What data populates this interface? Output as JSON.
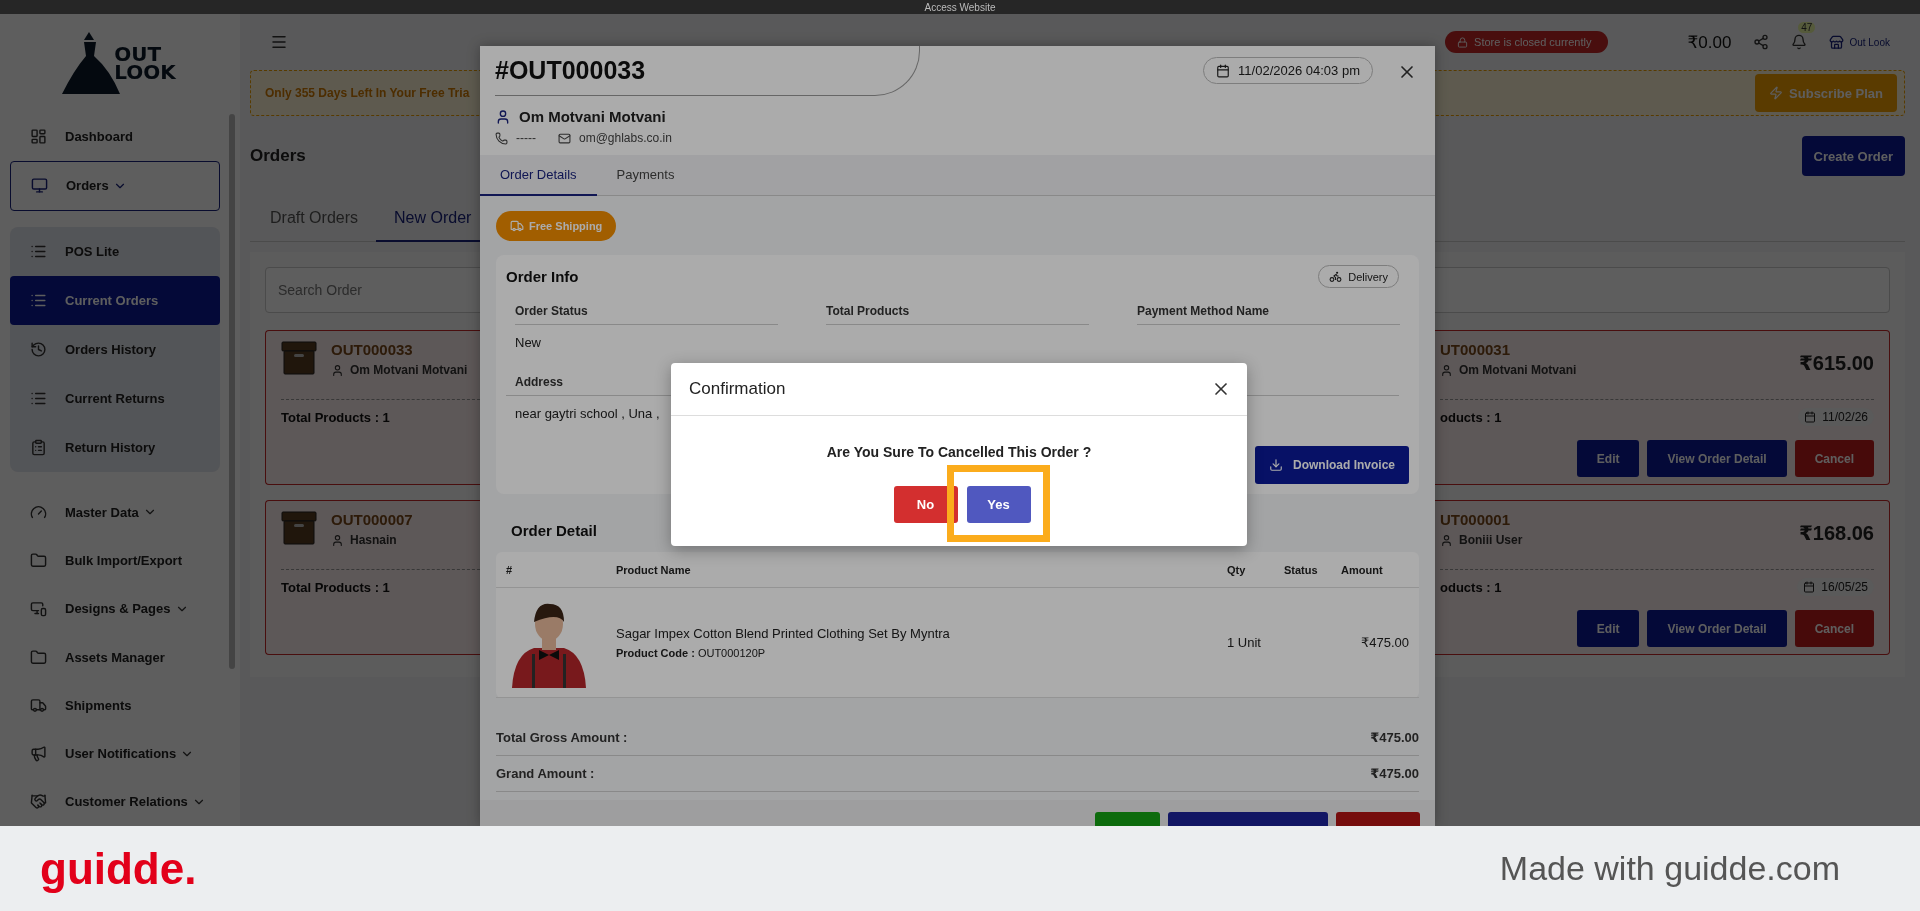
{
  "top_bar": {
    "title": "Access Website"
  },
  "sidebar": {
    "logo": {
      "line1": "OUT",
      "line2": "LOOK"
    },
    "items": [
      {
        "label": "Dashboard",
        "expandable": false,
        "expanded": false
      },
      {
        "label": "Orders",
        "expandable": true,
        "expanded": true,
        "children": [
          {
            "label": "POS Lite",
            "selected": false
          },
          {
            "label": "Current Orders",
            "selected": true
          },
          {
            "label": "Orders History",
            "selected": false
          },
          {
            "label": "Current Returns",
            "selected": false
          },
          {
            "label": "Return History",
            "selected": false
          }
        ]
      },
      {
        "label": "Master Data",
        "expandable": true,
        "expanded": false
      },
      {
        "label": "Bulk Import/Export",
        "expandable": false,
        "expanded": false
      },
      {
        "label": "Designs & Pages",
        "expandable": true,
        "expanded": false
      },
      {
        "label": "Assets Manager",
        "expandable": false,
        "expanded": false
      },
      {
        "label": "Shipments",
        "expandable": false,
        "expanded": false
      },
      {
        "label": "User Notifications",
        "expandable": true,
        "expanded": false
      },
      {
        "label": "Customer Relations",
        "expandable": true,
        "expanded": false
      }
    ]
  },
  "header": {
    "store_status": "Store is closed currently",
    "balance": "₹0.00",
    "notification_count": "47",
    "store_name": "Out Look"
  },
  "trial_banner": {
    "text": "Only 355 Days Left In Your Free Tria",
    "button": "Subscribe Plan"
  },
  "page": {
    "title": "Orders",
    "create_button": "Create Order",
    "tabs": [
      {
        "label": "Draft Orders",
        "selected": false
      },
      {
        "label": "New Order",
        "selected": true
      }
    ],
    "search": {
      "placeholder": "Search Order"
    }
  },
  "orders_left": [
    {
      "id": "OUT000033",
      "customer": "Om Motvani Motvani",
      "total_products": "Total Products : 1"
    },
    {
      "id": "OUT000007",
      "customer": "Hasnain",
      "total_products": "Total Products : 1"
    }
  ],
  "orders_right": [
    {
      "id": "UT000031",
      "customer": "Om Motvani Motvani",
      "amount": "₹615.00",
      "total_products": "oducts : 1",
      "date": "11/02/26",
      "buttons": [
        {
          "label": "Edit",
          "kind": "primary"
        },
        {
          "label": "View Order Detail",
          "kind": "primary"
        },
        {
          "label": "Cancel",
          "kind": "danger"
        }
      ]
    },
    {
      "id": "UT000001",
      "customer": "Boniii User",
      "amount": "₹168.06",
      "total_products": "oducts : 1",
      "date": "16/05/25",
      "buttons": [
        {
          "label": "Edit",
          "kind": "primary"
        },
        {
          "label": "View Order Detail",
          "kind": "primary"
        },
        {
          "label": "Cancel",
          "kind": "danger"
        }
      ]
    }
  ],
  "drawer": {
    "order_number": "#OUT000033",
    "date": "11/02/2026 04:03 pm",
    "customer": "Om Motvani Motvani",
    "phone": "-----",
    "email": "om@ghlabs.co.in",
    "tabs": [
      {
        "label": "Order Details",
        "selected": true
      },
      {
        "label": "Payments",
        "selected": false
      }
    ],
    "shipping_badge": "Free Shipping",
    "order_info": {
      "title": "Order Info",
      "delivery_chip": "Delivery",
      "fields": [
        {
          "label": "Order Status",
          "value": "New"
        },
        {
          "label": "Total Products"
        },
        {
          "label": "Payment Method Name"
        }
      ],
      "address": {
        "label": "Address",
        "value": "near gaytri school , Una ,"
      },
      "download_button": "Download Invoice"
    },
    "order_detail": {
      "title": "Order Detail",
      "columns": [
        "#",
        "Product Name",
        "Qty",
        "Status",
        "Amount"
      ],
      "rows": [
        {
          "name": "Sagar Impex Cotton Blend Printed Clothing Set By Myntra",
          "code": "**Product Code :** OUT000120P",
          "qty": "1 Unit",
          "amount": "₹475.00"
        }
      ]
    },
    "totals": [
      {
        "label": "Total Gross Amount :",
        "value": "₹475.00"
      },
      {
        "label": "Grand Amount :",
        "value": "₹475.00"
      }
    ],
    "footer_buttons": [
      {
        "kind": "confirm"
      },
      {
        "kind": "primary"
      },
      {
        "kind": "danger"
      }
    ]
  },
  "confirm_dialog": {
    "title": "Confirmation",
    "message": "Are You Sure To Cancelled This Order ?",
    "buttons": [
      {
        "label": "No",
        "kind": "danger",
        "highlighted": false
      },
      {
        "label": "Yes",
        "kind": "primary",
        "highlighted": true
      }
    ]
  },
  "footer_brand": {
    "logo": "guidde.",
    "credit": "Made with guidde.com"
  }
}
